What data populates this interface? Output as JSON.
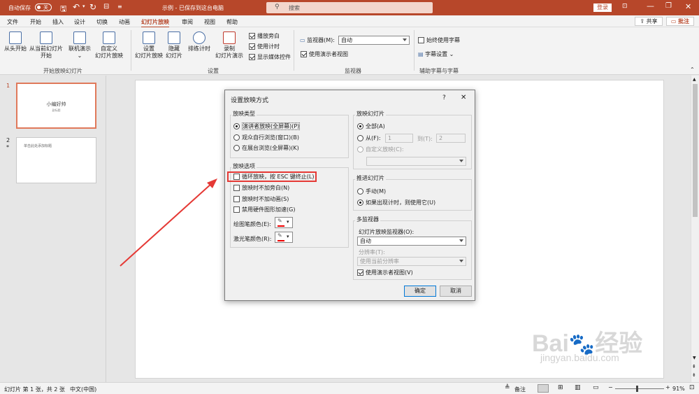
{
  "titlebar": {
    "autosave_label": "自动保存",
    "autosave_state": "关",
    "document_title": "示例 - 已保存到这台电脑",
    "search_placeholder": "搜索",
    "login_label": "登录"
  },
  "menu": {
    "tabs": [
      "文件",
      "开始",
      "插入",
      "设计",
      "切换",
      "动画",
      "幻灯片放映",
      "审阅",
      "视图",
      "帮助"
    ],
    "active_tab": "幻灯片放映",
    "share_label": "共享",
    "comments_label": "批注"
  },
  "ribbon": {
    "from_beginning": "从头开始",
    "from_current_1": "从当前幻灯片",
    "from_current_2": "开始",
    "online_present": "联机演示",
    "custom_1": "自定义",
    "custom_2": "幻灯片放映",
    "group_start": "开始放映幻灯片",
    "setup_1": "设置",
    "setup_2": "幻灯片放映",
    "hide_1": "隐藏",
    "hide_2": "幻灯片",
    "rehearse": "排练计时",
    "record_1": "录制",
    "record_2": "幻灯片演示",
    "play_narrations": "播放旁白",
    "use_timings": "使用计时",
    "show_media_controls": "显示媒体控件",
    "group_setup": "设置",
    "monitor_label": "监视器(M):",
    "monitor_value": "自动",
    "use_presenter_view": "使用演示者视图",
    "group_monitors": "监视器",
    "always_subtitles": "始终使用字幕",
    "subtitle_settings": "字幕设置",
    "group_captions": "辅助字幕与字幕"
  },
  "thumbnails": [
    {
      "number": "1",
      "title": "小编好帅",
      "subtitle": "副标题",
      "star": ""
    },
    {
      "number": "2",
      "title": "单击此处添加标题",
      "subtitle": "",
      "star": "*"
    }
  ],
  "dialog": {
    "title": "设置放映方式",
    "help": "?",
    "close": "✕",
    "show_type": {
      "title": "放映类型",
      "options": [
        "演讲者放映(全屏幕)(P)",
        "观众自行浏览(窗口)(B)",
        "在展台浏览(全屏幕)(K)"
      ]
    },
    "show_options": {
      "title": "放映选项",
      "loop": "循环放映，按 ESC 键终止(L)",
      "no_narration": "放映时不加旁白(N)",
      "no_animation": "放映时不加动画(S)",
      "disable_hw": "禁用硬件图形加速(G)",
      "pen_color": "绘图笔颜色(E):",
      "laser_color": "激光笔颜色(R):"
    },
    "show_slides": {
      "title": "放映幻灯片",
      "all": "全部(A)",
      "from": "从(F):",
      "from_value": "1",
      "to": "到(T):",
      "to_value": "2",
      "custom": "自定义放映(C):"
    },
    "advance": {
      "title": "推进幻灯片",
      "manual": "手动(M)",
      "timings": "如果出现计时，则使用它(U)"
    },
    "monitors": {
      "title": "多监视器",
      "monitor_label": "幻灯片放映监视器(O):",
      "monitor_value": "自动",
      "resolution_label": "分辨率(T):",
      "resolution_value": "使用当前分辨率",
      "presenter_view": "使用演示者视图(V)"
    },
    "ok": "确定",
    "cancel": "取消"
  },
  "statusbar": {
    "slide_info": "幻灯片 第 1 张，共 2 张",
    "language": "中文(中国)",
    "notes": "备注",
    "zoom": "91%"
  },
  "colors": {
    "accent": "#b7472a",
    "highlight_box": "#e53935",
    "arrow": "#e53935"
  }
}
